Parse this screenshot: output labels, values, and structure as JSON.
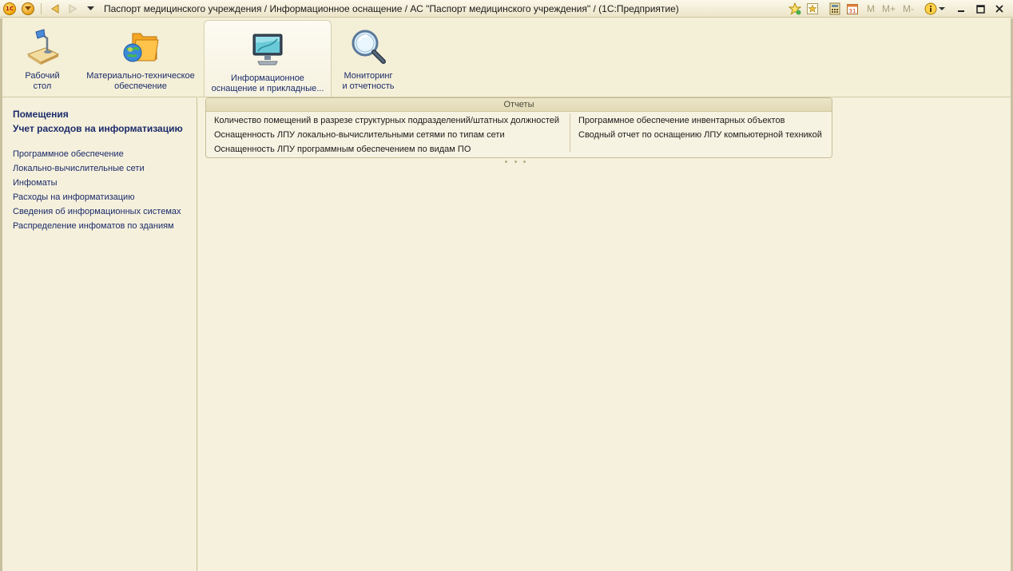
{
  "window": {
    "title": "Паспорт медицинского учреждения / Информационное оснащение / АС \"Паспорт медицинского учреждения\" /  (1С:Предприятие)",
    "logo_text": "1С",
    "calc_buttons": [
      "M",
      "M+",
      "M-"
    ],
    "calendar_day": "31"
  },
  "sections": [
    {
      "label": "Рабочий\nстол",
      "icon": "desk-lamp-icon",
      "active": false
    },
    {
      "label": "Материально-техническое\nобеспечение",
      "icon": "folder-globe-icon",
      "active": false
    },
    {
      "label": "Информационное\nоснащение и прикладные...",
      "icon": "monitor-icon",
      "active": true
    },
    {
      "label": "Мониторинг\nи отчетность",
      "icon": "magnifier-icon",
      "active": false
    }
  ],
  "left_panel": {
    "primary": [
      "Помещения",
      "Учет расходов на информатизацию"
    ],
    "links": [
      "Программное обеспечение",
      "Локально-вычислительные сети",
      "Инфоматы",
      "Расходы на информатизацию",
      "Сведения об информационных системах",
      "Распределение инфоматов по зданиям"
    ]
  },
  "reports": {
    "title": "Отчеты",
    "column1": [
      "Количество помещений в разрезе структурных подразделений/штатных должностей",
      "Оснащенность ЛПУ локально-вычислительными сетями по типам сети",
      "Оснащенность ЛПУ программным обеспечением по видам ПО"
    ],
    "column2": [
      "Программное обеспечение инвентарных объектов",
      "Сводный отчет по оснащению ЛПУ компьютерной техникой"
    ]
  }
}
